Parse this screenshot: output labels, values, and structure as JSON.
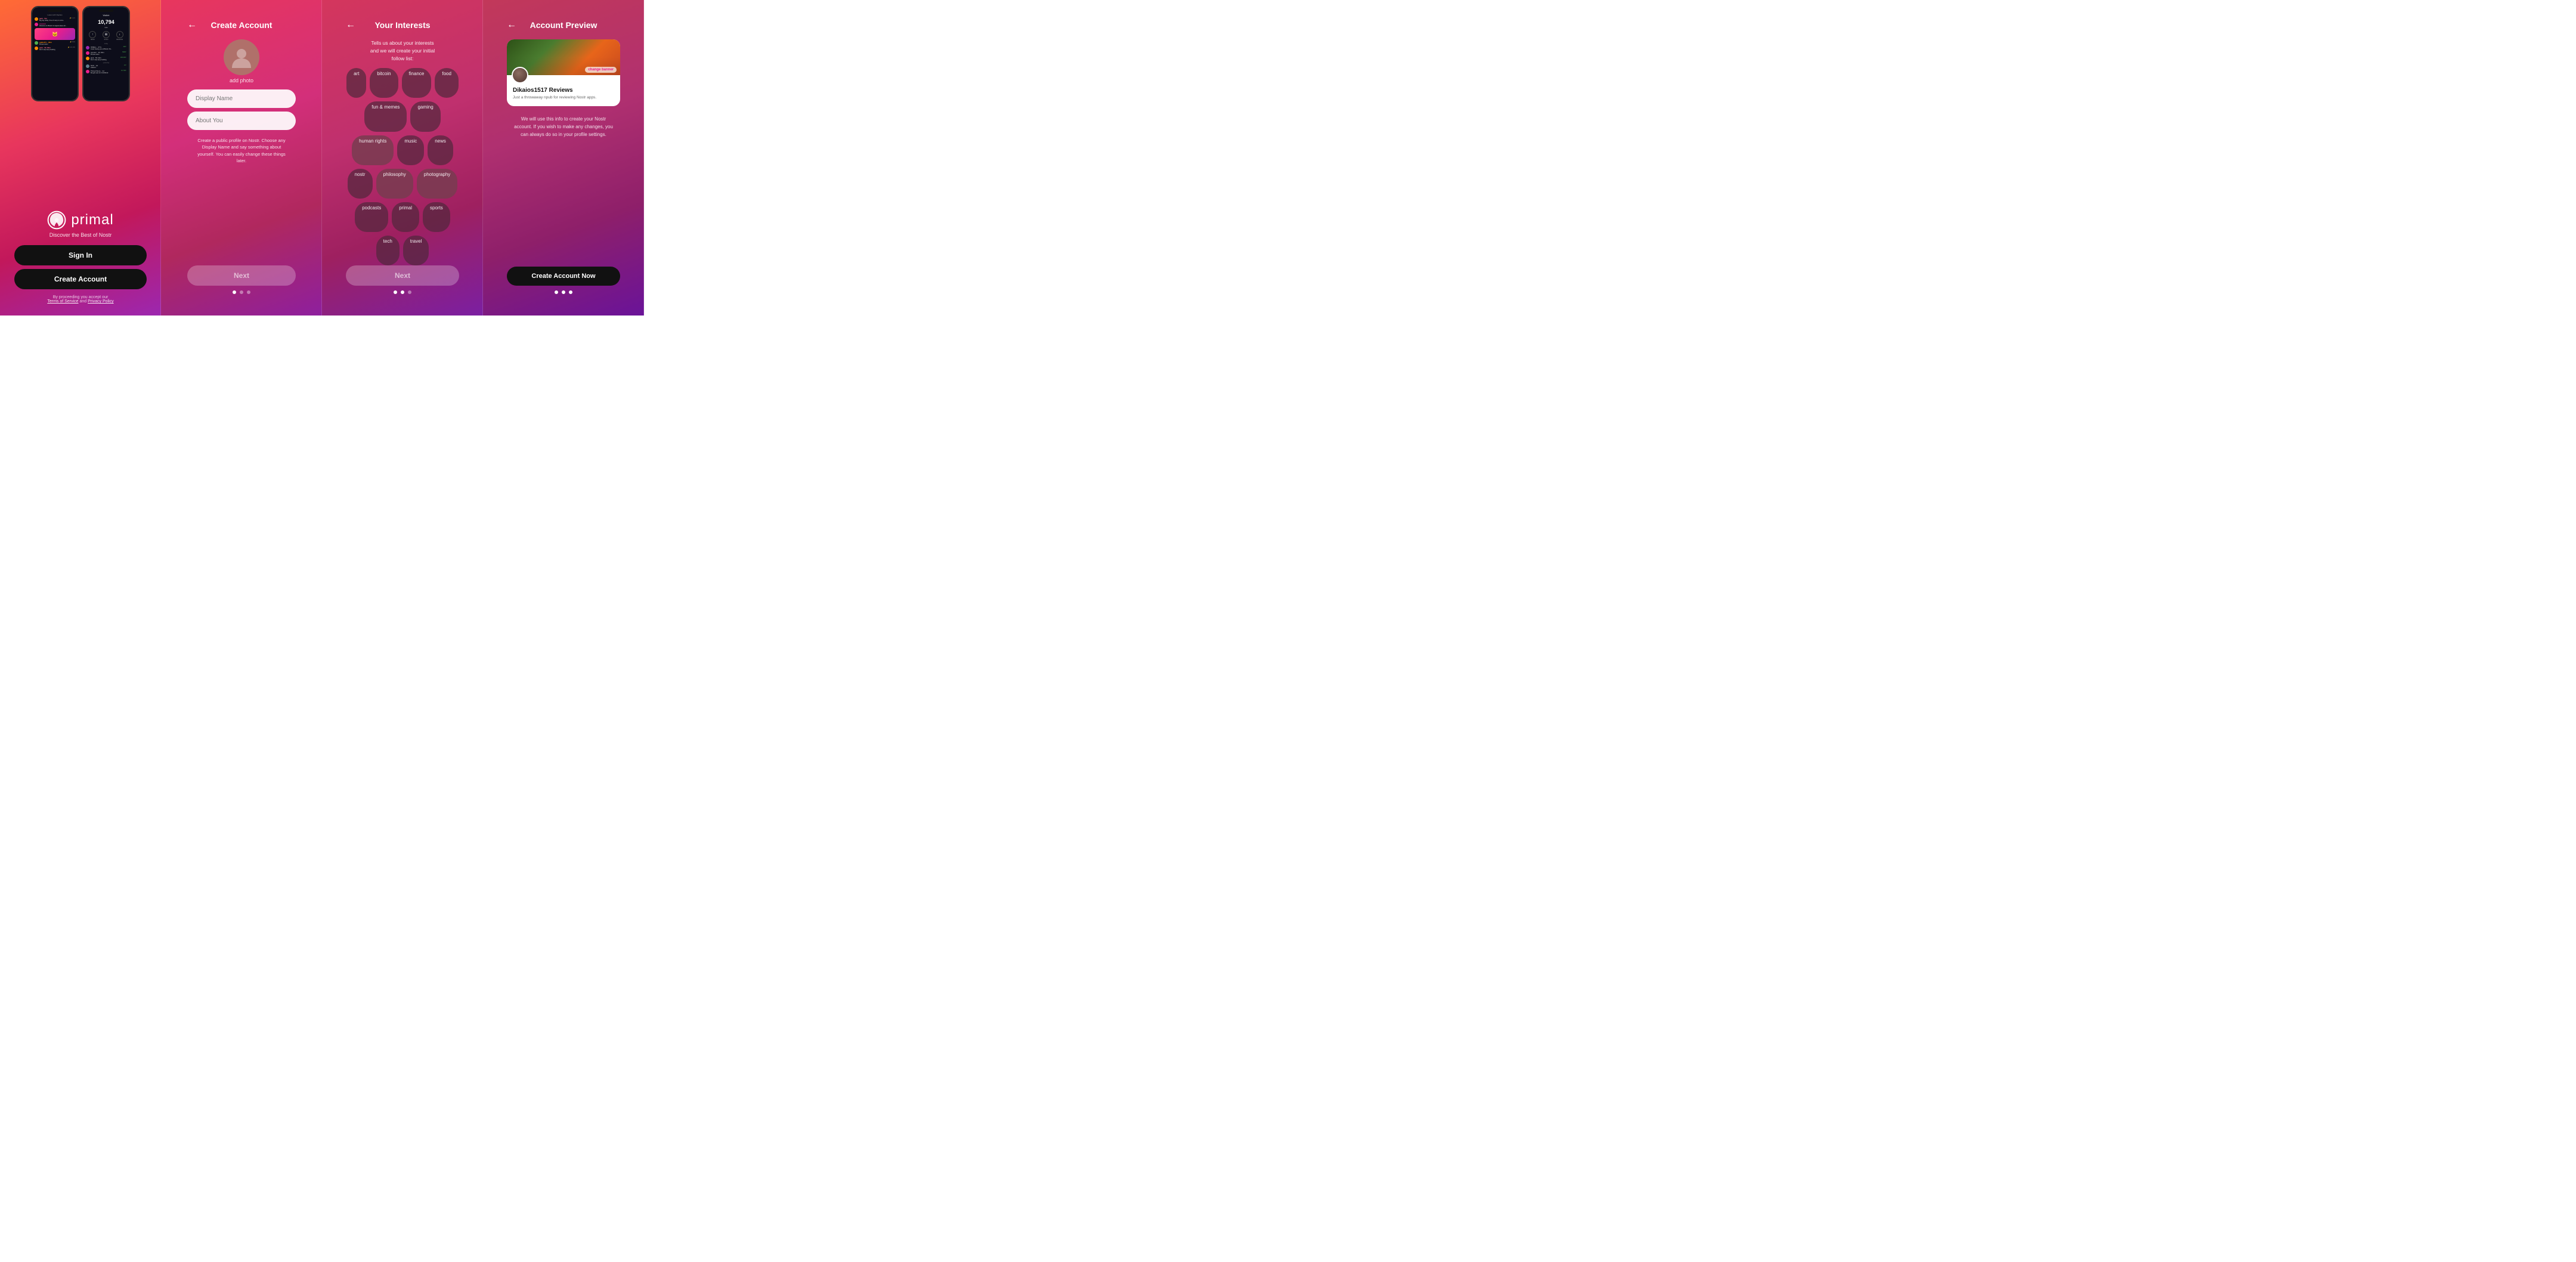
{
  "panel1": {
    "logo_text": "primal",
    "tagline": "Discover the Best of Nostr",
    "sign_in_label": "Sign In",
    "create_account_label": "Create Account",
    "terms_text": "By proceeding you accept our",
    "terms_of_service": "Terms of Service",
    "and": "and",
    "privacy_policy": "Privacy Policy",
    "phone1": {
      "header": "Latest with Replies",
      "chats": [
        {
          "name": "jack · 5m",
          "text": "Big day today. One of many to come."
        },
        {
          "name": "preston",
          "text": "Welcome to #Nostr! A magical place wh..."
        },
        {
          "name": "pablof7z · 32m",
          "text": "Primal rocks!"
        },
        {
          "name": "jack · 5h 32m",
          "text": "Don't stop keep building"
        }
      ]
    },
    "phone2": {
      "header": "Wallet",
      "amount": "10,794",
      "unit": "sats",
      "actions": [
        "SEND",
        "SCAN",
        "RECEIVE"
      ],
      "transactions": [
        {
          "name": "ODELL · 27m",
          "amount": "420",
          "text": "Great having you at Bitcoin Pa..."
        },
        {
          "name": "preston · 2h 33m",
          "amount": "5000",
          "text": "Primal rocks!"
        },
        {
          "name": "jack · 5h 32m",
          "amount": "100,000",
          "text": "Don't stop keep building"
        },
        {
          "name": "NVK · 1d",
          "amount": "21",
          "text": "Called it"
        },
        {
          "name": "Primal Store · 1d",
          "amount": "10,794",
          "text": "Bought sats for 0.99 $5.00"
        }
      ]
    }
  },
  "panel2": {
    "back_arrow": "←",
    "title": "Create Account",
    "add_photo_label": "add photo",
    "display_name_placeholder": "Display Name",
    "about_you_placeholder": "About You",
    "helper_text": "Create a public profile on Nostr. Choose any Display Name and say something about yourself. You can easily change these things later.",
    "next_label": "Next",
    "dots": [
      true,
      false,
      false
    ]
  },
  "panel3": {
    "back_arrow": "←",
    "title": "Your Interests",
    "subtitle": "Tells us about your interests\nand we will create your initial\nfollow list:",
    "interests": [
      {
        "label": "art",
        "selected": false
      },
      {
        "label": "bitcoin",
        "selected": false
      },
      {
        "label": "finance",
        "selected": false
      },
      {
        "label": "food",
        "selected": false
      },
      {
        "label": "fun & memes",
        "selected": false
      },
      {
        "label": "gaming",
        "selected": false
      },
      {
        "label": "human rights",
        "selected": true
      },
      {
        "label": "music",
        "selected": false
      },
      {
        "label": "news",
        "selected": false
      },
      {
        "label": "nostr",
        "selected": false
      },
      {
        "label": "philosophy",
        "selected": true
      },
      {
        "label": "photography",
        "selected": true
      },
      {
        "label": "podcasts",
        "selected": false
      },
      {
        "label": "primal",
        "selected": false
      },
      {
        "label": "sports",
        "selected": false
      },
      {
        "label": "tech",
        "selected": false
      },
      {
        "label": "travel",
        "selected": false
      }
    ],
    "next_label": "Next",
    "dots": [
      true,
      true,
      false
    ]
  },
  "panel4": {
    "back_arrow": "←",
    "title": "Account Preview",
    "change_banner_label": "change banner",
    "display_name": "Dikaios1517 Reviews",
    "bio": "Just a throwaway npub for reviewing\nNostr apps.",
    "info_text": "We will use this info to create your Nostr account. If you wish to make any changes, you can always do so in your profile settings.",
    "create_account_now_label": "Create Account Now",
    "dots": [
      true,
      true,
      true
    ]
  }
}
